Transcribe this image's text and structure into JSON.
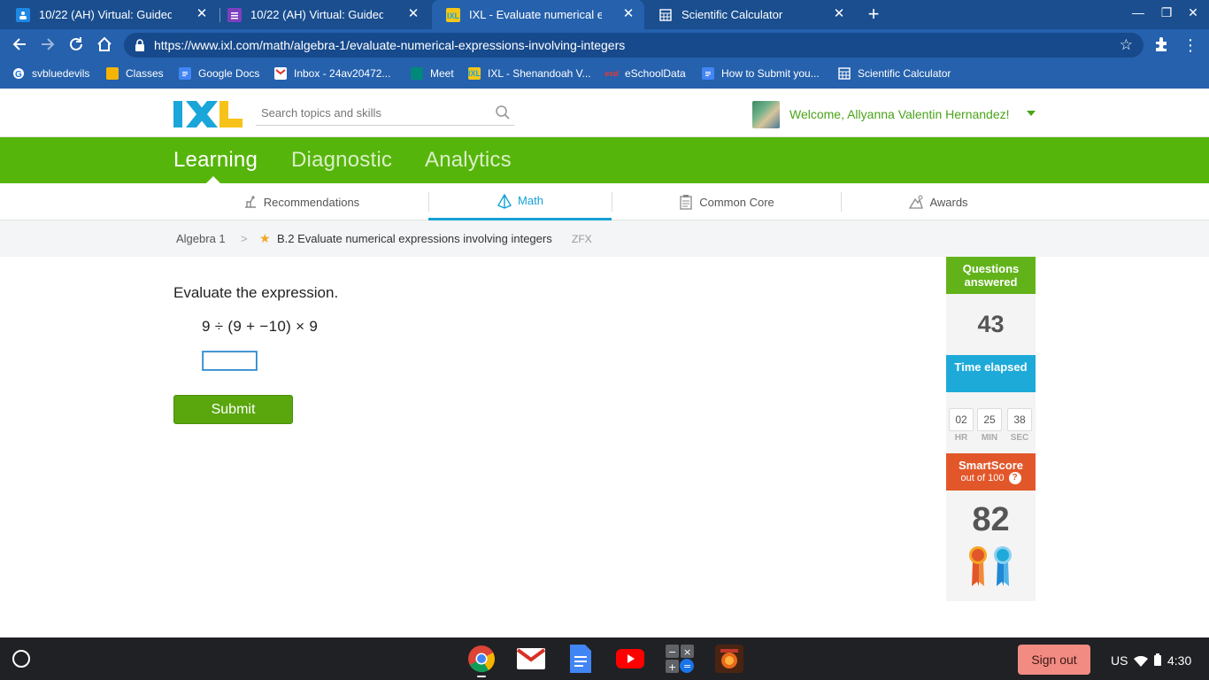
{
  "browser": {
    "tabs": [
      {
        "title": "10/22 (AH) Virtual: Guided Read",
        "icon": "classroom-icon",
        "color": "#1e88e5"
      },
      {
        "title": "10/22 (AH) Virtual: Guided Read",
        "icon": "forms-icon",
        "color": "#7e3fbf"
      },
      {
        "title": "IXL - Evaluate numerical express",
        "icon": "ixl-icon",
        "color": "#f5c518"
      },
      {
        "title": "Scientific Calculator",
        "icon": "calculator-icon",
        "color": "#ffffff"
      }
    ],
    "url": "https://www.ixl.com/math/algebra-1/evaluate-numerical-expressions-involving-integers",
    "bookmarks": [
      {
        "label": "svbluedevils",
        "icon": "google-icon"
      },
      {
        "label": "Classes",
        "icon": "classroom-icon"
      },
      {
        "label": "Google Docs",
        "icon": "docs-icon"
      },
      {
        "label": "Inbox - 24av20472...",
        "icon": "gmail-icon"
      },
      {
        "label": "Meet",
        "icon": "meet-icon"
      },
      {
        "label": "IXL - Shenandoah V...",
        "icon": "ixl-icon"
      },
      {
        "label": "eSchoolData",
        "icon": "eschooldata-icon"
      },
      {
        "label": "How to Submit you...",
        "icon": "docs-icon"
      },
      {
        "label": "Scientific Calculator",
        "icon": "calculator-icon"
      }
    ]
  },
  "ixl": {
    "logo_text": "IXL",
    "search_placeholder": "Search topics and skills",
    "welcome": "Welcome, Allyanna Valentin Hernandez!",
    "main_nav": [
      "Learning",
      "Diagnostic",
      "Analytics"
    ],
    "sub_nav": [
      "Recommendations",
      "Math",
      "Common Core",
      "Awards"
    ],
    "breadcrumb": {
      "parent": "Algebra 1",
      "separator": ">",
      "skill": "B.2 Evaluate numerical expressions involving integers",
      "code": "ZFX"
    },
    "colors": {
      "green": "#56b50a",
      "blue": "#16a1d6",
      "orange": "#e2572a"
    }
  },
  "question": {
    "prompt": "Evaluate the expression.",
    "expression": "9 ÷ (9 + −10) × 9",
    "answer_value": "",
    "submit_label": "Submit"
  },
  "stats": {
    "questions_answered_label": "Questions answered",
    "questions_answered": "43",
    "time_label": "Time elapsed",
    "time": {
      "hr": "02",
      "min": "25",
      "sec": "38"
    },
    "time_units": {
      "hr": "HR",
      "min": "MIN",
      "sec": "SEC"
    },
    "smartscore_label": "SmartScore",
    "smartscore_sub": "out of 100",
    "smartscore": "82"
  },
  "shelf": {
    "signout_label": "Sign out",
    "locale": "US",
    "clock": "4:30"
  }
}
